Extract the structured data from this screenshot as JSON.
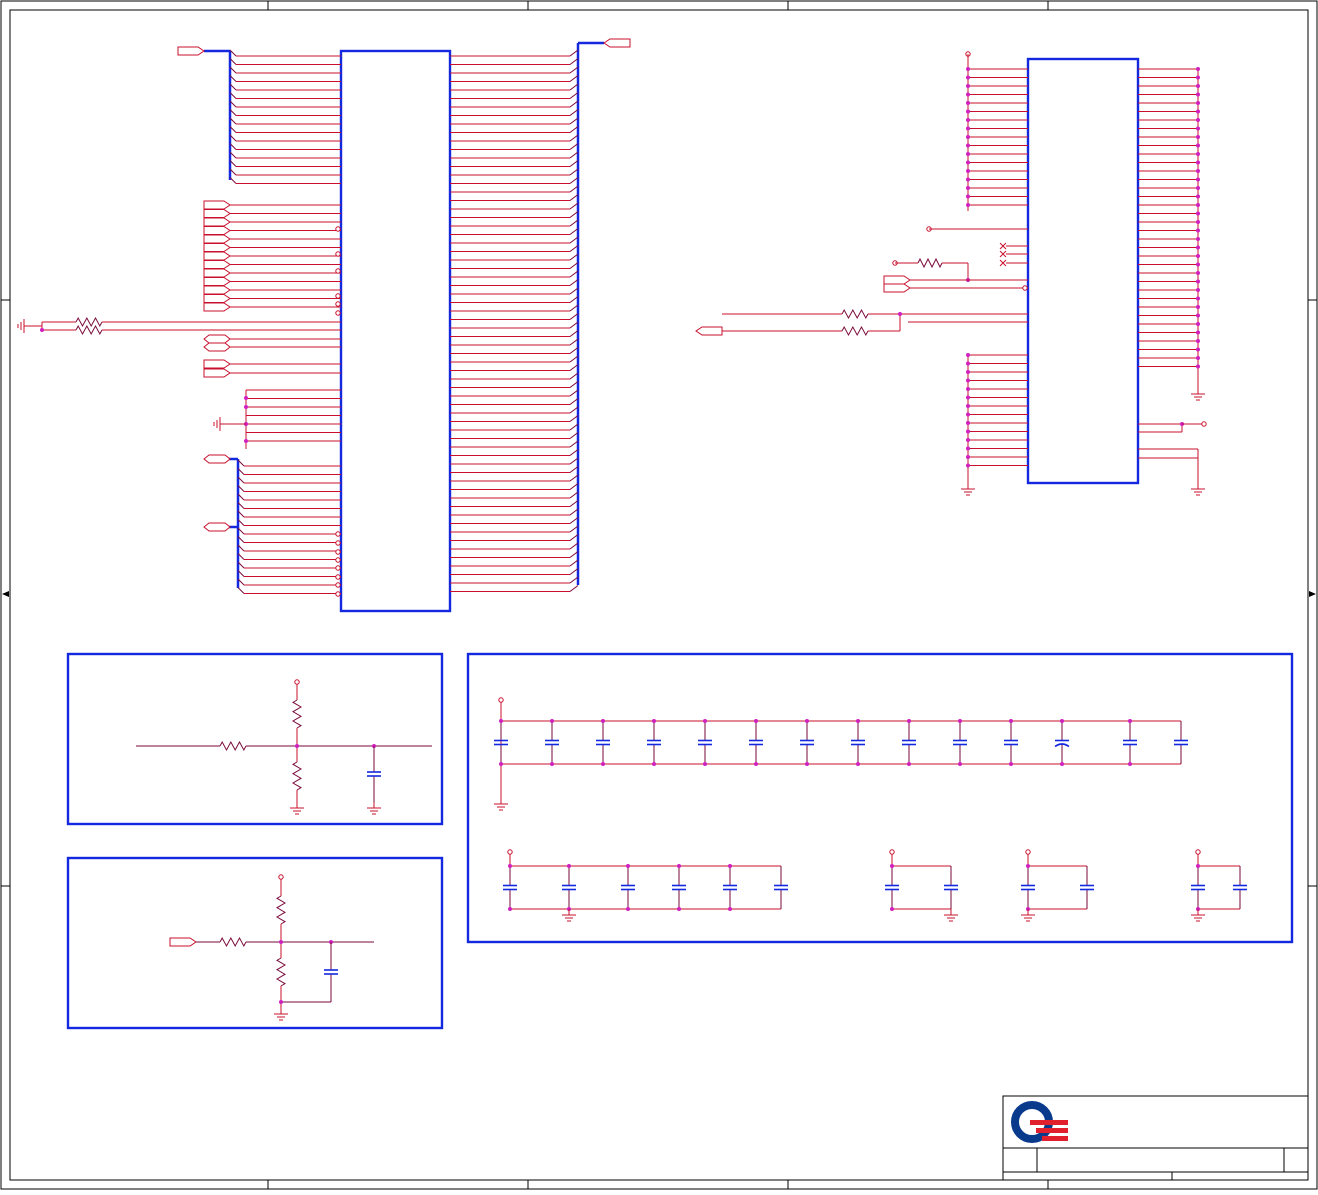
{
  "sheet": {
    "title_block": {
      "logo": "quanta-logo",
      "logo_colors": [
        "#0a3a8c",
        "#e0202c"
      ]
    }
  },
  "colors": {
    "border": "#000000",
    "box": "#1428e0",
    "wire": "#c8102e",
    "wire_dark": "#7a0a3a",
    "junction": "#d020c0",
    "bus": "#1428e0"
  }
}
